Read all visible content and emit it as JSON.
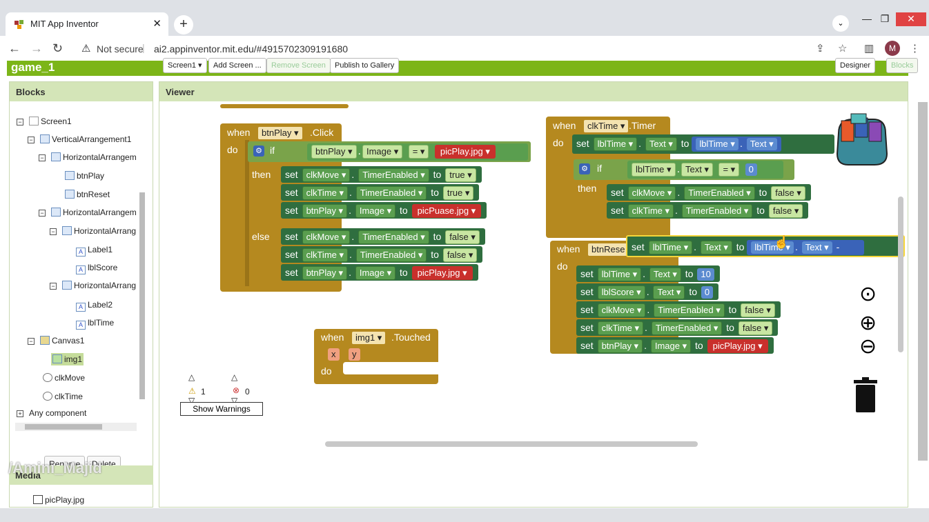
{
  "browser": {
    "tab_title": "MIT App Inventor",
    "not_secure": "Not secure",
    "url": "ai2.appinventor.mit.edu/#4915702309191680",
    "avatar": "M"
  },
  "app": {
    "project": "game_1",
    "screen_btn": "Screen1 ▾",
    "add_screen": "Add Screen ...",
    "remove_screen": "Remove Screen",
    "publish": "Publish to Gallery",
    "designer": "Designer",
    "blocks": "Blocks"
  },
  "panels": {
    "blocks": "Blocks",
    "viewer": "Viewer",
    "media": "Media",
    "rename": "Rename",
    "delete": "Delete"
  },
  "tree": {
    "screen1": "Screen1",
    "va1": "VerticalArrangement1",
    "ha1": "HorizontalArrangem",
    "btnplay": "btnPlay",
    "btnreset": "btnReset",
    "ha2": "HorizontalArrangem",
    "ha3": "HorizontalArrang",
    "label1": "Label1",
    "lblscore": "lblScore",
    "ha4": "HorizontalArrang",
    "label2": "Label2",
    "lbltime": "lblTime",
    "canvas1": "Canvas1",
    "img1": "img1",
    "clkmove": "clkMove",
    "clktime": "clkTime",
    "any": "Any component"
  },
  "media": {
    "file1": "picPlay.jpg"
  },
  "blocks": {
    "when": "when",
    "do": "do",
    "if": "if",
    "then": "then",
    "else": "else",
    "set": "set",
    "to": "to",
    "btnPlay": "btnPlay ▾",
    "click": ".Click",
    "image": "Image ▾",
    "eq": "= ▾",
    "picPlay": "picPlay.jpg ▾",
    "picPuase": "picPuase.jpg ▾",
    "clkMove": "clkMove ▾",
    "clkTime": "clkTime ▾",
    "timerEnabled": "TimerEnabled ▾",
    "true": "true ▾",
    "false": "false ▾",
    "timer": ".Timer",
    "lblTime": "lblTime ▾",
    "text": "Text ▾",
    "zero": "0",
    "ten": "10",
    "lblScore": "lblScore ▾",
    "btnReset": "btnRese",
    "img1": "img1 ▾",
    "touched": ".Touched",
    "x": "x",
    "y": "y",
    "minus": "-"
  },
  "warnings": {
    "count": "1",
    "errors": "0",
    "show": "Show Warnings"
  },
  "watermark": "/Amini_Majid"
}
